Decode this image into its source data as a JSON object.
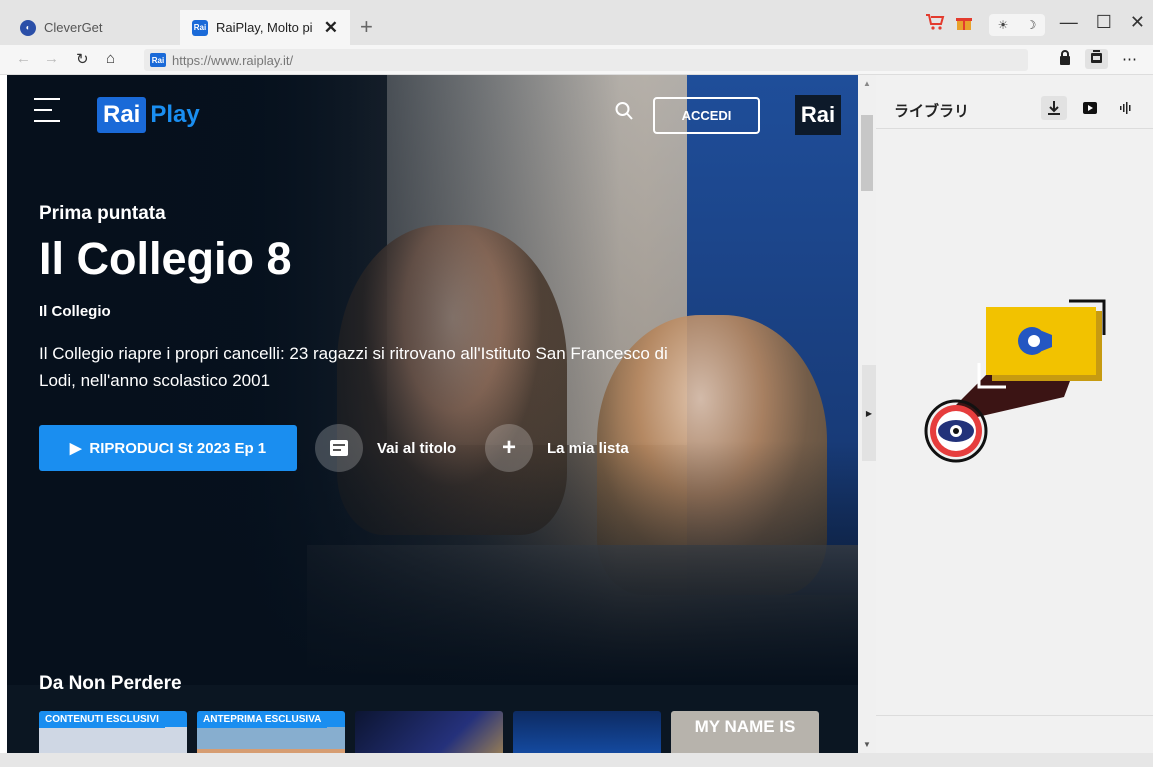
{
  "browser": {
    "tabs": [
      {
        "label": "CleverGet",
        "favicon": "clever-icon",
        "active": false
      },
      {
        "label": "RaiPlay, Molto pi",
        "favicon": "Rai",
        "active": true
      }
    ],
    "address": "https://www.raiplay.it/",
    "address_favicon": "Rai"
  },
  "site": {
    "logo_rai": "Rai",
    "logo_play": "Play",
    "login_label": "ACCEDI",
    "rai_badge": "Rai",
    "hero": {
      "eyebrow": "Prima puntata",
      "title": "Il Collegio 8",
      "subtitle": "Il Collegio",
      "description": "Il Collegio riapre i propri cancelli: 23 ragazzi si ritrovano all'Istituto San Francesco di Lodi, nell'anno scolastico 2001",
      "play_label": "RIPRODUCI St 2023 Ep 1",
      "goto_label": "Vai al titolo",
      "mylist_label": "La mia lista"
    },
    "section": {
      "title": "Da Non Perdere",
      "cards": [
        {
          "badge": "CONTENUTI ESCLUSIVI",
          "text": ""
        },
        {
          "badge": "ANTEPRIMA ESCLUSIVA",
          "text": ""
        },
        {
          "badge": "",
          "text": ""
        },
        {
          "badge": "",
          "text": ""
        },
        {
          "badge": "",
          "text": "MY NAME IS"
        }
      ]
    }
  },
  "library": {
    "title": "ライブラリ"
  },
  "colors": {
    "accent": "#1a8ef0",
    "brand_blue": "#1a6ad8",
    "page_bg": "#0b1622"
  }
}
